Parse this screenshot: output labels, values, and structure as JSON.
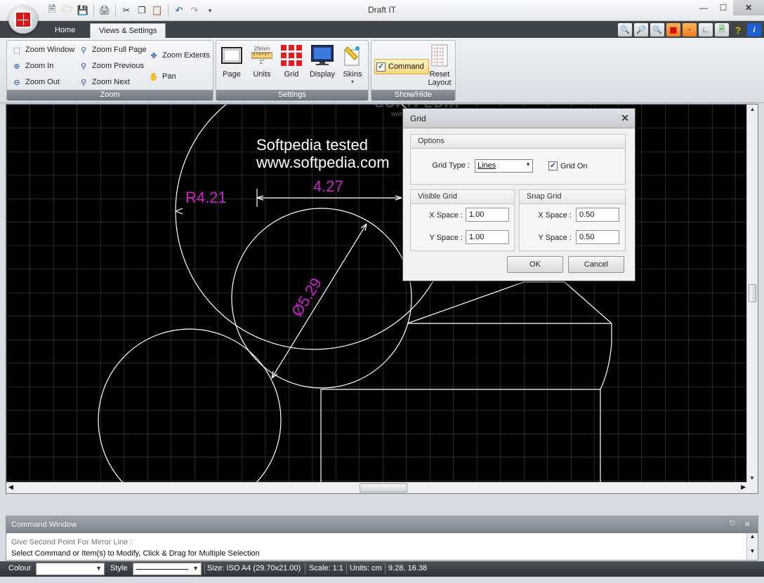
{
  "window": {
    "title": "Draft IT"
  },
  "tabs": [
    {
      "label": "Home"
    },
    {
      "label": "Views & Settings"
    }
  ],
  "ribbon": {
    "zoom_group": {
      "label": "Zoom",
      "buttons": {
        "zoom_window": "Zoom Window",
        "zoom_in": "Zoom In",
        "zoom_out": "Zoom Out",
        "zoom_full_page": "Zoom Full Page",
        "zoom_previous": "Zoom Previous",
        "zoom_next": "Zoom Next",
        "zoom_extents": "Zoom Extents",
        "pan": "Pan"
      }
    },
    "settings_group": {
      "label": "Settings",
      "buttons": {
        "page": "Page",
        "units": "Units",
        "grid": "Grid",
        "display": "Display",
        "skins": "Skins"
      },
      "units_icon_top": "25mm",
      "units_icon_bottom": "1\""
    },
    "showhide_group": {
      "label": "Show/Hide",
      "command": "Command",
      "command_checked": true,
      "reset_layout": "Reset\nLayout"
    }
  },
  "canvas": {
    "annotations": {
      "watermark_line1": "Softpedia tested",
      "watermark_line2": "www.softpedia.com",
      "radius_label": "R4.21",
      "length_label": "4.27",
      "diameter_label": "Ø5.29"
    },
    "colors": {
      "background": "#000000",
      "grid": "#4a4a4a",
      "geometry": "#ffffff",
      "dimension": "#cc22cc"
    },
    "watermark_overlay": {
      "brand": "SOFTPEDIA",
      "url": "www.softpedia.com"
    }
  },
  "grid_dialog": {
    "title": "Grid",
    "options": {
      "heading": "Options",
      "grid_type_label": "Grid Type :",
      "grid_type_value": "Lines",
      "grid_on_label": "Grid On",
      "grid_on_checked": true
    },
    "visible_grid": {
      "heading": "Visible Grid",
      "x_label": "X Space :",
      "x_value": "1.00",
      "y_label": "Y Space :",
      "y_value": "1.00"
    },
    "snap_grid": {
      "heading": "Snap Grid",
      "x_label": "X Space :",
      "x_value": "0.50",
      "y_label": "Y Space :",
      "y_value": "0.50"
    },
    "ok_label": "OK",
    "cancel_label": "Cancel"
  },
  "command_window": {
    "title": "Command Window",
    "previous_line": "Give Second Point For Mirror Line :",
    "current_line": "Select Command or Item(s) to Modify, Click & Drag for Multiple Selection"
  },
  "status_bar": {
    "colour_label": "Colour",
    "style_label": "Style",
    "size": "Size: ISO A4 (29.70x21.00)",
    "scale": "Scale: 1:1",
    "units": "Units: cm",
    "coords": "9.28, 16.38"
  }
}
